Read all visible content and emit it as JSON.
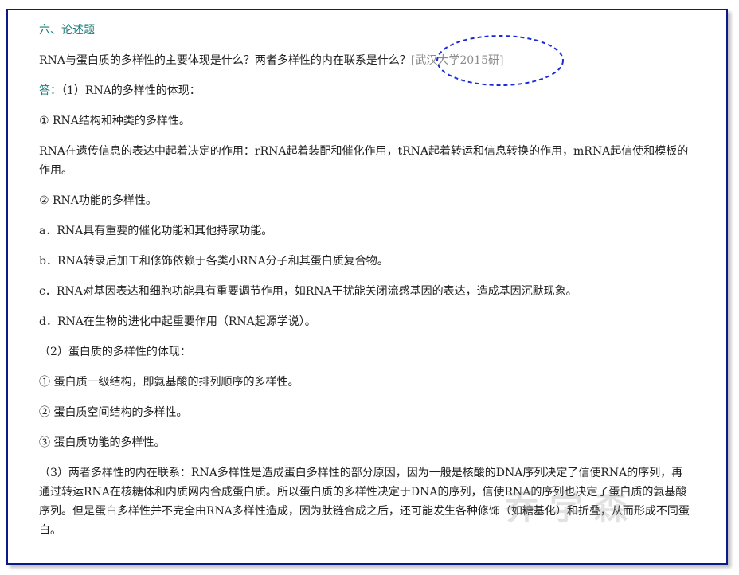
{
  "section_title": "六、论述题",
  "question": {
    "text": "RNA与蛋白质的多样性的主要体现是什么？两者多样性的内在联系是什么？",
    "source": "[武汉大学2015研]"
  },
  "answer": {
    "label": "答：",
    "intro": "（1）RNA的多样性的体现：",
    "p1": "① RNA结构和种类的多样性。",
    "p2": "RNA在遗传信息的表达中起着决定的作用：rRNA起着装配和催化作用，tRNA起着转运和信息转换的作用，mRNA起信使和模板的作用。",
    "p3": "② RNA功能的多样性。",
    "p4": "a．RNA具有重要的催化功能和其他持家功能。",
    "p5": "b．RNA转录后加工和修饰依赖于各类小RNA分子和其蛋白质复合物。",
    "p6": "c．RNA对基因表达和细胞功能具有重要调节作用，如RNA干扰能关闭流感基因的表达，造成基因沉默现象。",
    "p7": "d．RNA在生物的进化中起重要作用（RNA起源学说）。",
    "p8": "（2）蛋白质的多样性的体现：",
    "p9": "① 蛋白质一级结构，即氨基酸的排列顺序的多样性。",
    "p10": "② 蛋白质空间结构的多样性。",
    "p11": "③ 蛋白质功能的多样性。",
    "p12": "（3）两者多样性的内在联系：RNA多样性是造成蛋白多样性的部分原因，因为一般是核酸的DNA序列决定了信使RNA的序列，再通过转运RNA在核糖体和内质网内合成蛋白质。所以蛋白质的多样性决定于DNA的序列，信使RNA的序列也决定了蛋白质的氨基酸序列。但是蛋白多样性并不完全由RNA多样性造成，因为肽链合成之后，还可能发生各种修饰（如糖基化）和折叠，从而形成不同蛋白。"
  },
  "watermark": "乔学森",
  "colors": {
    "frame_border": "#0a1a8c",
    "title_teal": "#1c7b78",
    "oval_blue": "#1b2bd6",
    "source_gray": "#8a8a8a"
  }
}
